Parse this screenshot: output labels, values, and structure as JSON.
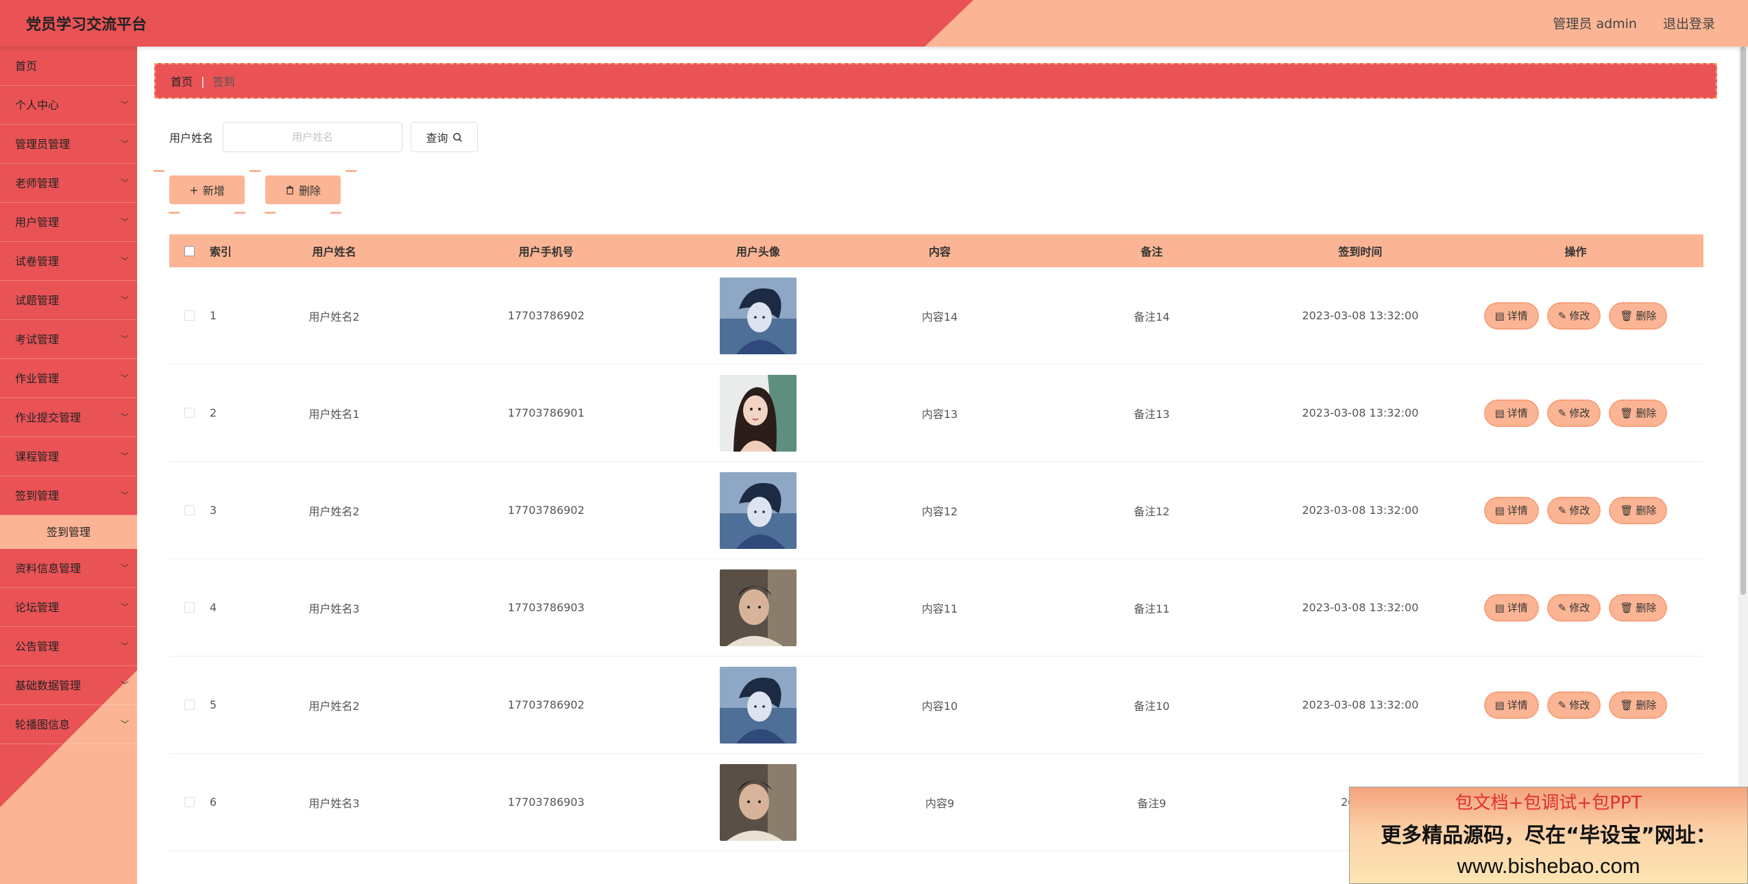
{
  "header": {
    "title": "党员学习交流平台",
    "user": "管理员 admin",
    "logout": "退出登录"
  },
  "sidebar": {
    "items": [
      {
        "label": "首页",
        "chevron": false
      },
      {
        "label": "个人中心",
        "chevron": true
      },
      {
        "label": "管理员管理",
        "chevron": true
      },
      {
        "label": "老师管理",
        "chevron": true
      },
      {
        "label": "用户管理",
        "chevron": true
      },
      {
        "label": "试卷管理",
        "chevron": true
      },
      {
        "label": "试题管理",
        "chevron": true
      },
      {
        "label": "考试管理",
        "chevron": true
      },
      {
        "label": "作业管理",
        "chevron": true
      },
      {
        "label": "作业提交管理",
        "chevron": true
      },
      {
        "label": "课程管理",
        "chevron": true
      },
      {
        "label": "签到管理",
        "chevron": true
      }
    ],
    "sub_item": "签到管理",
    "items_after": [
      {
        "label": "资料信息管理",
        "chevron": true
      },
      {
        "label": "论坛管理",
        "chevron": true
      },
      {
        "label": "公告管理",
        "chevron": true
      },
      {
        "label": "基础数据管理",
        "chevron": true
      },
      {
        "label": "轮播图信息",
        "chevron": true
      }
    ]
  },
  "breadcrumb": {
    "home": "首页",
    "separator": "|",
    "current": "签到"
  },
  "search": {
    "label": "用户姓名",
    "placeholder": "用户姓名",
    "value": "",
    "button": "查询"
  },
  "actions": {
    "add": "新增",
    "delete": "删除"
  },
  "table": {
    "headers": [
      "索引",
      "用户姓名",
      "用户手机号",
      "用户头像",
      "内容",
      "备注",
      "签到时间",
      "操作"
    ],
    "ops": {
      "detail": "详情",
      "edit": "修改",
      "delete": "删除"
    },
    "rows": [
      {
        "index": "1",
        "name": "用户姓名2",
        "phone": "17703786902",
        "avatar": "avatar-boy-illustration",
        "content": "内容14",
        "note": "备注14",
        "time": "2023-03-08 13:32:00"
      },
      {
        "index": "2",
        "name": "用户姓名1",
        "phone": "17703786901",
        "avatar": "avatar-girl-illustration",
        "content": "内容13",
        "note": "备注13",
        "time": "2023-03-08 13:32:00"
      },
      {
        "index": "3",
        "name": "用户姓名2",
        "phone": "17703786902",
        "avatar": "avatar-boy-illustration",
        "content": "内容12",
        "note": "备注12",
        "time": "2023-03-08 13:32:00"
      },
      {
        "index": "4",
        "name": "用户姓名3",
        "phone": "17703786903",
        "avatar": "avatar-boy-photo",
        "content": "内容11",
        "note": "备注11",
        "time": "2023-03-08 13:32:00"
      },
      {
        "index": "5",
        "name": "用户姓名2",
        "phone": "17703786902",
        "avatar": "avatar-boy-illustration",
        "content": "内容10",
        "note": "备注10",
        "time": "2023-03-08 13:32:00"
      },
      {
        "index": "6",
        "name": "用户姓名3",
        "phone": "17703786903",
        "avatar": "avatar-boy-photo",
        "content": "内容9",
        "note": "备注9",
        "time": "2023-0"
      }
    ]
  },
  "watermark": {
    "line1": "包文档+包调试+包PPT",
    "line2": "更多精品源码，尽在“毕设宝”网址：",
    "line3": "www.bishebao.com"
  },
  "colors": {
    "primary_red": "#e95356",
    "accent_peach": "#fbb594"
  }
}
